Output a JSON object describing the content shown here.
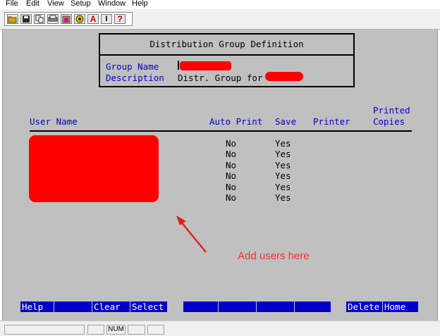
{
  "menu": [
    "File",
    "Edit",
    "View",
    "Setup",
    "Window",
    "Help"
  ],
  "toolbar_icons": [
    "folder-open-icon",
    "save-icon",
    "copy-icon",
    "print-icon",
    "paste-icon",
    "settings-icon",
    "font-icon",
    "text-size-icon",
    "help-icon"
  ],
  "toolbar_glyphs": {
    "font": "A",
    "text_size": "I",
    "help": "?"
  },
  "header": {
    "title": "Distribution Group Definition",
    "group_name_label": "Group Name",
    "description_label": "Description",
    "description_value": "Distr. Group for"
  },
  "table": {
    "columns": {
      "user_name": "User Name",
      "auto_print": "Auto Print",
      "save": "Save",
      "printer": "Printer",
      "printed_copies_line1": "Printed",
      "printed_copies_line2": "Copies"
    },
    "rows": [
      {
        "auto_print": "No",
        "save": "Yes"
      },
      {
        "auto_print": "No",
        "save": "Yes"
      },
      {
        "auto_print": "No",
        "save": "Yes"
      },
      {
        "auto_print": "No",
        "save": "Yes"
      },
      {
        "auto_print": "No",
        "save": "Yes"
      },
      {
        "auto_print": "No",
        "save": "Yes"
      }
    ]
  },
  "annotation": {
    "text": "Add users here"
  },
  "function_keys": [
    "Help",
    "",
    "Clear",
    "Select",
    "",
    "",
    "",
    "",
    "Delete",
    "Home"
  ],
  "status": {
    "num": "NUM"
  },
  "colors": {
    "screen_bg": "#c0c0c0",
    "label_blue": "#0000c8",
    "redaction": "#ff0000",
    "annotation": "#ff2a2a"
  }
}
